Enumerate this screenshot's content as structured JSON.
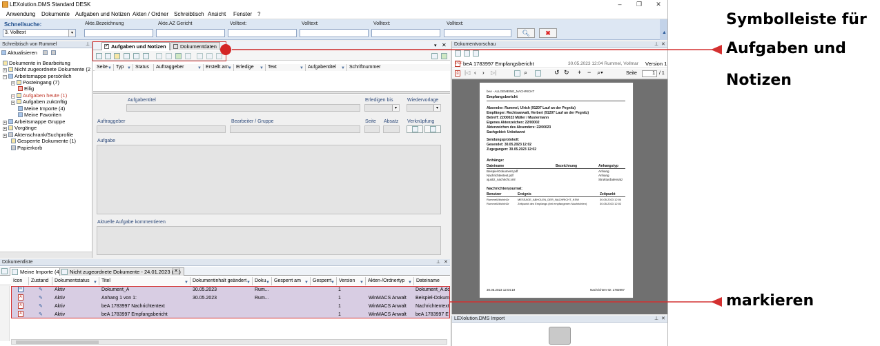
{
  "window": {
    "title": "LEXolution.DMS Standard DESK",
    "controls": [
      "–",
      "❐",
      "✕"
    ]
  },
  "menu": [
    "Anwendung",
    "Dokumente",
    "Aufgaben und Notizen",
    "Akten / Ordner",
    "Schreibtisch",
    "Ansicht",
    "Fenster",
    "?"
  ],
  "quicksearch": {
    "label": "Schnellsuche:",
    "mode_value": "3. Volltext",
    "fields": [
      "Akte.Bezeichnung",
      "Akte.AZ Gericht",
      "Volltext:",
      "Volltext:",
      "Volltext:",
      "Volltext:"
    ]
  },
  "left_pane": {
    "title": "Schreibtisch von Rummel",
    "refresh_label": "Aktualisieren",
    "tree": [
      "Dokumente in Bearbeitung",
      "Nicht zugeordnete Dokumente (2",
      "Arbeitsmappe persönlich",
      "Posteingang (7)",
      "Eilig",
      "Aufgaben heute (1)",
      "Aufgaben zukünftig",
      "Meine Importe (4)",
      "Meine Favoriten",
      "Arbeitsmappe Gruppe",
      "Vorgänge",
      "Aktenschrank/Suchprofile",
      "Gesperrte Dokumente (1)",
      "Papierkorb"
    ]
  },
  "tasks_pane": {
    "tabs": [
      "Aufgaben und Notizen",
      "Dokumentdaten"
    ],
    "columns": [
      "Seite",
      "Typ",
      "Status",
      "Auftraggeber",
      "Erstellt am",
      "Erledige",
      "Text",
      "Aufgabentitel",
      "Schriftnummer"
    ],
    "form": {
      "aufgabentitel": "Aufgabentitel",
      "erledigen_bis": "Erledigen bis",
      "wiedervorlage": "Wiedervorlage",
      "auftraggeber": "Auftraggeber",
      "bearbeiter": "Bearbeiter / Gruppe",
      "seite": "Seite",
      "absatz": "Absatz",
      "verknuepfung": "Verknüpfung",
      "aufgabe": "Aufgabe",
      "kommentieren": "Aktuelle Aufgabe kommentieren"
    }
  },
  "preview": {
    "title": "Dokumentvorschau",
    "doc_title": "beA 1783997 Empfangsbericht",
    "doc_meta": "30.05.2023 12:04 Rummel, Vollmar",
    "version": "Version 1",
    "page_label": "Seite",
    "page_value": "1",
    "page_total": "/ 1",
    "page": {
      "header": "beA - ALLGEMEINE_NACHRICHT",
      "title": "Empfangsbericht",
      "lines": [
        "Absender: Rummel, Ulrich (91207 Lauf an der Pegnitz)",
        "Empfänger: Rechtsanwalt, Herbert (91207 Lauf an der Pegnitz)",
        "Betreff: 22/00023 Müller / Mustermann",
        "Eigenes Aktenzeichen: 22/00002",
        "Aktenzeichen des Absenders: 22/00023",
        "Sachgebiet: Unbekannt"
      ],
      "send_lines": [
        "Sendungsprotokoll:",
        "Gesendet: 30.05.2023 12:02",
        "Zugegangen: 30.05.2023 12:02"
      ],
      "attachments_title": "Anhänge:",
      "attach_cols": [
        "Dateiname",
        "Bezeichnung",
        "Anhangstyp"
      ],
      "attachments": [
        [
          "Beispiel-Dokument.pdf",
          "Anhang"
        ],
        [
          "Nachrichtentext.pdf",
          "Anhang"
        ],
        [
          "xjustiz_nachricht.xml",
          "Strukturdatensatz"
        ]
      ],
      "journal_title": "Nachrichtenjournal:",
      "journal_cols": [
        "Benutzer",
        "Ereignis",
        "Zeitpunkt"
      ],
      "journal": [
        [
          "RummelUlrichInDr",
          "MESSAGE_ABHOLEN_DER_NACHRICHT_KSW",
          "30.05.2023 12:04"
        ],
        [
          "RummelUlrichInDr",
          "Zeitpunkt des Empfangs (bei empfangenen Nachrichten)",
          "30.05.2023 12:02"
        ]
      ],
      "footer_left": "30.05.2023 12:04:19",
      "footer_right": "Nachrichten-ID: 1783997"
    },
    "import_title": "LEXolution.DMS Import"
  },
  "doclist": {
    "title": "Dokumentliste",
    "tabs": [
      "Meine Importe (4)",
      "Nicht zugeordnete Dokumente - 24.01.2023 (24)"
    ],
    "columns": [
      "Icon",
      "Zustand",
      "Dokumentstatus",
      "Titel",
      "Dokumentinhalt geändert",
      "Doku",
      "Gesperrt am",
      "Gesperrt",
      "Version",
      "Akten-/Ordnertyp",
      "Dateiname"
    ],
    "rows": [
      {
        "status": "Aktiv",
        "titel": "Dokument_A",
        "datum": "30.05.2023",
        "doku": "Rum...",
        "version": "1",
        "typ": "",
        "datei": "Dokument_A.do"
      },
      {
        "status": "Aktiv",
        "titel": "Anhang 1 von 1:",
        "datum": "30.05.2023",
        "doku": "Rum...",
        "version": "1",
        "typ": "WinMACS Anwalt",
        "datei": "Beispiel-Dokum"
      },
      {
        "status": "Aktiv",
        "titel": "beA 1783997 Nachrichtentext",
        "datum": "",
        "doku": "",
        "version": "1",
        "typ": "WinMACS Anwalt",
        "datei": "Nachrichtentext."
      },
      {
        "status": "Aktiv",
        "titel": "beA 1783997 Empfangsbericht",
        "datum": "",
        "doku": "",
        "version": "1",
        "typ": "WinMACS Anwalt",
        "datei": "beA 1783997 E"
      }
    ]
  },
  "annotations": {
    "line1": "Symbolleiste für",
    "line2": "Aufgaben und",
    "line3": "Notizen",
    "markieren": "markieren",
    "colors": {
      "highlight": "#d43030",
      "row_fill": "#d8cde3"
    }
  }
}
